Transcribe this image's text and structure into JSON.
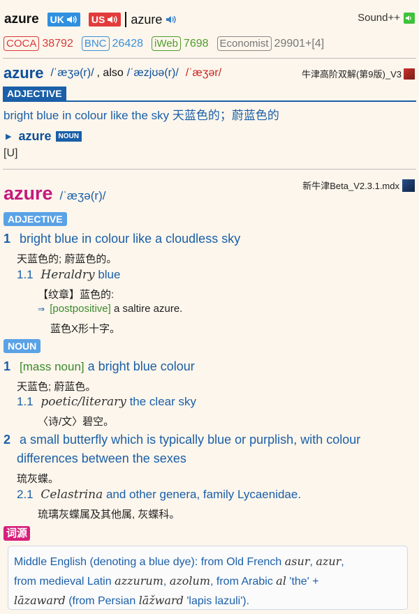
{
  "header": {
    "word": "azure",
    "uk_label": "UK",
    "us_label": "US",
    "word2": "azure",
    "sound_label": "Sound++"
  },
  "freq": {
    "coca_label": "COCA",
    "coca_value": "38792",
    "bnc_label": "BNC",
    "bnc_value": "26428",
    "iweb_label": "iWeb",
    "iweb_value": "7698",
    "econ_label": "Economist",
    "econ_value": "29901+[4]"
  },
  "oxford": {
    "word": "azure",
    "pron1": "/ˈæʒə(r)/",
    "also": ", also",
    "pron2": "/ˈæzjʊə(r)/",
    "pron3": "/ˈæʒər/",
    "source": "牛津高阶双解(第9版)_V3",
    "pos": "ADJECTIVE",
    "definition": "bright blue in colour like the sky 天蓝色的；蔚蓝色的",
    "related_word": "azure",
    "related_pos": "NOUN",
    "grammar": "[U]"
  },
  "noad": {
    "source": "新牛津Beta_V2.3.1.mdx",
    "word": "azure",
    "pron": "/ˈæʒə(r)/",
    "adj_tag": "ADJECTIVE",
    "s1_num": "1",
    "s1_def": "bright blue in colour like a cloudless sky",
    "s1_zh": "天蓝色的; 蔚蓝色的。",
    "s11_num": "1.1",
    "s11_label": "Heraldry",
    "s11_def": "blue",
    "s11_zh": "【纹章】蓝色的:",
    "ex_arrow": "⇒",
    "ex_grammar": "[postpositive]",
    "ex_text": "a saltire azure.",
    "ex_zh": "蓝色X形十字。",
    "noun_tag": "NOUN",
    "n1_num": "1",
    "n1_grammar": "[mass noun]",
    "n1_def": "a bright blue colour",
    "n1_zh": "天蓝色; 蔚蓝色。",
    "n11_num": "1.1",
    "n11_label": "poetic/literary",
    "n11_def": "the clear sky",
    "n11_zh": "〈诗/文〉碧空。",
    "n2_num": "2",
    "n2_def_a": "a small butterfly which is typically blue or purplish, with colour",
    "n2_def_b": "differences between the sexes",
    "n2_zh": "琉灰蝶。",
    "n21_num": "2.1",
    "n21_label": "Celastrina",
    "n21_def": "and other genera, family Lycaenidae.",
    "n21_zh": "琉璃灰蝶属及其他属, 灰蝶科。",
    "ety_tag": "词源",
    "ety_line1_a": "Middle English (denoting a blue dye): from Old French",
    "ety_line1_b": "asur",
    "ety_line1_c": ",",
    "ety_line1_d": "azur",
    "ety_line1_e": ",",
    "ety_line2_a": "from medieval Latin",
    "ety_line2_b": "azzurum",
    "ety_line2_c": ",",
    "ety_line2_d": "azolum",
    "ety_line2_e": ", from Arabic",
    "ety_line2_f": "al",
    "ety_line2_g": "'the' +",
    "ety_line3_a": "lāzaward",
    "ety_line3_b": "(from Persian",
    "ety_line3_c": "lāžward",
    "ety_line3_d": "'lapis lazuli')."
  },
  "colors": {
    "uk_bg": "#2f8fe0",
    "us_bg": "#e33b3b",
    "coca": "#d73a3a",
    "bnc": "#3b8fd9",
    "iweb": "#4f9c2c",
    "econ": "#888888",
    "oxford_head": "#0b4f9c",
    "noad_head": "#c4197d",
    "tag": "#5aa2e6",
    "ety_tag": "#d6217c"
  }
}
